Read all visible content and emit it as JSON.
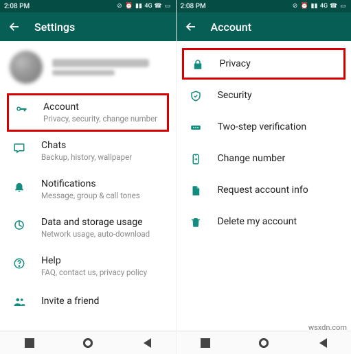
{
  "statusbar": {
    "time": "2:08 PM",
    "net": "4G"
  },
  "left": {
    "title": "Settings",
    "items": [
      {
        "id": "account",
        "title": "Account",
        "subtitle": "Privacy, security, change number",
        "highlight": true
      },
      {
        "id": "chats",
        "title": "Chats",
        "subtitle": "Backup, history, wallpaper"
      },
      {
        "id": "notif",
        "title": "Notifications",
        "subtitle": "Message, group & call tones"
      },
      {
        "id": "data",
        "title": "Data and storage usage",
        "subtitle": "Network usage, auto-download"
      },
      {
        "id": "help",
        "title": "Help",
        "subtitle": "FAQ, contact us, privacy policy"
      },
      {
        "id": "invite",
        "title": "Invite a friend",
        "subtitle": ""
      }
    ]
  },
  "right": {
    "title": "Account",
    "items": [
      {
        "id": "privacy",
        "title": "Privacy",
        "highlight": true
      },
      {
        "id": "security",
        "title": "Security"
      },
      {
        "id": "twostep",
        "title": "Two-step verification"
      },
      {
        "id": "change",
        "title": "Change number"
      },
      {
        "id": "request",
        "title": "Request account info"
      },
      {
        "id": "delete",
        "title": "Delete my account"
      }
    ]
  },
  "watermark": "wsxdn.com",
  "colors": {
    "accent": "#128c7e",
    "appbar": "#075e54",
    "statusbar": "#054c44",
    "highlight": "#d40000"
  }
}
